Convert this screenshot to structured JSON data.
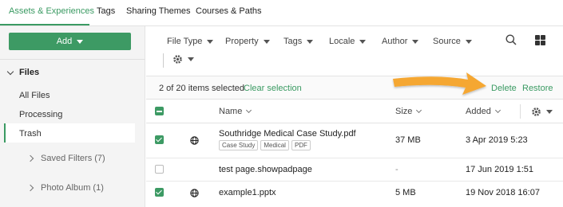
{
  "tabs": [
    {
      "label": "Assets & Experiences",
      "active": true
    },
    {
      "label": "Tags",
      "active": false
    },
    {
      "label": "Sharing Themes",
      "active": false
    },
    {
      "label": "Courses & Paths",
      "active": false
    }
  ],
  "sidebar": {
    "add_label": "Add",
    "files_label": "Files",
    "items": [
      {
        "label": "All Files"
      },
      {
        "label": "Processing"
      },
      {
        "label": "Trash",
        "active": true
      }
    ],
    "groups": [
      {
        "label": "Saved Filters (7)"
      },
      {
        "label": "Photo Album (1)"
      }
    ]
  },
  "filters": [
    "File Type",
    "Property",
    "Tags",
    "Locale",
    "Author",
    "Source"
  ],
  "selection": {
    "count_text": "2 of 20 items selected",
    "clear_label": "Clear selection",
    "delete_label": "Delete",
    "restore_label": "Restore"
  },
  "columns": {
    "name": "Name",
    "size": "Size",
    "added": "Added"
  },
  "rows": [
    {
      "name": "Southridge Medical Case Study.pdf",
      "tags": [
        "Case Study",
        "Medical",
        "PDF"
      ],
      "size": "37 MB",
      "added": "3 Apr 2019 5:23",
      "checked": true,
      "icon": "globe-icon"
    },
    {
      "name": "test page.showpadpage",
      "tags": [],
      "size": "-",
      "added": "17 Jun 2019 1:51",
      "checked": false,
      "icon": ""
    },
    {
      "name": "example1.pptx",
      "tags": [],
      "size": "5 MB",
      "added": "19 Nov 2018 16:07",
      "checked": true,
      "icon": "globe-icon"
    }
  ],
  "colors": {
    "accent": "#3a9a62",
    "button": "#3d9a64",
    "annotation_arrow": "#f5a733"
  }
}
